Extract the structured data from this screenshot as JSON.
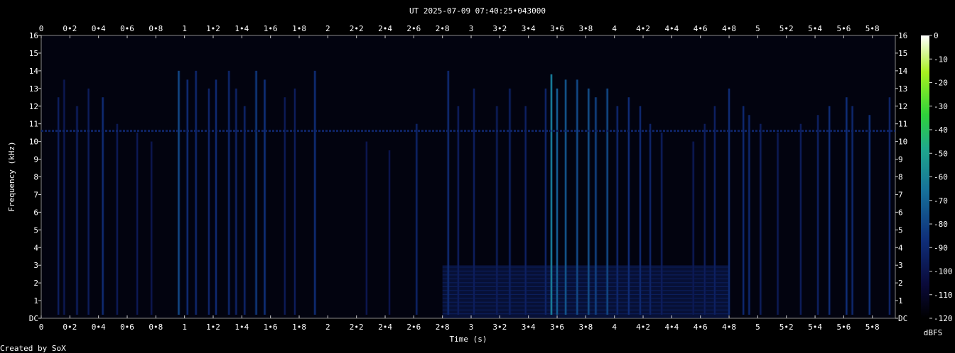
{
  "title": "UT 2025-07-09 07:40:25•043000",
  "credit": "Created by SoX",
  "chart_data": {
    "type": "heatmap",
    "xlabel": "Time (s)",
    "ylabel": "Frequency (kHz)",
    "xlim": [
      0,
      5.96
    ],
    "ylim": [
      0,
      16
    ],
    "x_ticks": [
      "0",
      "0•2",
      "0•4",
      "0•6",
      "0•8",
      "1",
      "1•2",
      "1•4",
      "1•6",
      "1•8",
      "2",
      "2•2",
      "2•4",
      "2•6",
      "2•8",
      "3",
      "3•2",
      "3•4",
      "3•6",
      "3•8",
      "4",
      "4•2",
      "4•4",
      "4•6",
      "4•8",
      "5",
      "5•2",
      "5•4",
      "5•6",
      "5•8"
    ],
    "y_ticks": [
      "DC",
      "1",
      "2",
      "3",
      "4",
      "5",
      "6",
      "7",
      "8",
      "9",
      "10",
      "11",
      "12",
      "13",
      "14",
      "15",
      "16"
    ],
    "colorbar": {
      "label": "dBFS",
      "ticks": [
        "0",
        "-10",
        "-20",
        "-30",
        "-40",
        "-50",
        "-60",
        "-70",
        "-80",
        "-90",
        "-100",
        "-110",
        "-120"
      ],
      "range": [
        -120,
        0
      ],
      "colors": [
        "#000000",
        "#0a0a3a",
        "#0f2f7a",
        "#16709a",
        "#1fa88c",
        "#2fd23a",
        "#a8f020",
        "#ffffff"
      ]
    },
    "tones": [
      {
        "freq_khz": 10.6,
        "t_start": 0,
        "t_end": 5.96,
        "level_db": -92
      }
    ],
    "events": [
      {
        "t": 0.12,
        "top_khz": 12.5,
        "level_db": -95
      },
      {
        "t": 0.16,
        "top_khz": 13.5,
        "level_db": -98
      },
      {
        "t": 0.25,
        "top_khz": 12.0,
        "level_db": -94
      },
      {
        "t": 0.33,
        "top_khz": 13.0,
        "level_db": -96
      },
      {
        "t": 0.43,
        "top_khz": 12.5,
        "level_db": -88
      },
      {
        "t": 0.53,
        "top_khz": 11.0,
        "level_db": -97
      },
      {
        "t": 0.67,
        "top_khz": 10.5,
        "level_db": -98
      },
      {
        "t": 0.77,
        "top_khz": 10.0,
        "level_db": -99
      },
      {
        "t": 0.96,
        "top_khz": 14.0,
        "level_db": -78
      },
      {
        "t": 1.02,
        "top_khz": 13.5,
        "level_db": -88
      },
      {
        "t": 1.08,
        "top_khz": 14.0,
        "level_db": -90
      },
      {
        "t": 1.17,
        "top_khz": 13.0,
        "level_db": -92
      },
      {
        "t": 1.22,
        "top_khz": 13.5,
        "level_db": -89
      },
      {
        "t": 1.31,
        "top_khz": 14.0,
        "level_db": -90
      },
      {
        "t": 1.36,
        "top_khz": 13.0,
        "level_db": -92
      },
      {
        "t": 1.42,
        "top_khz": 12.0,
        "level_db": -91
      },
      {
        "t": 1.5,
        "top_khz": 14.0,
        "level_db": -83
      },
      {
        "t": 1.56,
        "top_khz": 13.5,
        "level_db": -86
      },
      {
        "t": 1.7,
        "top_khz": 12.5,
        "level_db": -97
      },
      {
        "t": 1.77,
        "top_khz": 13.0,
        "level_db": -96
      },
      {
        "t": 1.91,
        "top_khz": 14.0,
        "level_db": -87
      },
      {
        "t": 2.27,
        "top_khz": 10.0,
        "level_db": -99
      },
      {
        "t": 2.43,
        "top_khz": 9.5,
        "level_db": -100
      },
      {
        "t": 2.62,
        "top_khz": 11.0,
        "level_db": -92
      },
      {
        "t": 2.84,
        "top_khz": 14.0,
        "level_db": -88
      },
      {
        "t": 2.91,
        "top_khz": 12.0,
        "level_db": -95
      },
      {
        "t": 3.02,
        "top_khz": 13.0,
        "level_db": -95
      },
      {
        "t": 3.18,
        "top_khz": 12.0,
        "level_db": -95
      },
      {
        "t": 3.27,
        "top_khz": 13.0,
        "level_db": -93
      },
      {
        "t": 3.38,
        "top_khz": 12.0,
        "level_db": -94
      },
      {
        "t": 3.52,
        "top_khz": 13.0,
        "level_db": -92
      },
      {
        "t": 3.56,
        "top_khz": 13.8,
        "level_db": -62
      },
      {
        "t": 3.6,
        "top_khz": 13.0,
        "level_db": -72
      },
      {
        "t": 3.66,
        "top_khz": 13.5,
        "level_db": -74
      },
      {
        "t": 3.74,
        "top_khz": 13.5,
        "level_db": -78
      },
      {
        "t": 3.82,
        "top_khz": 13.0,
        "level_db": -76
      },
      {
        "t": 3.87,
        "top_khz": 12.5,
        "level_db": -80
      },
      {
        "t": 3.95,
        "top_khz": 13.0,
        "level_db": -78
      },
      {
        "t": 4.02,
        "top_khz": 12.0,
        "level_db": -90
      },
      {
        "t": 4.1,
        "top_khz": 12.5,
        "level_db": -88
      },
      {
        "t": 4.18,
        "top_khz": 12.0,
        "level_db": -90
      },
      {
        "t": 4.25,
        "top_khz": 11.0,
        "level_db": -92
      },
      {
        "t": 4.33,
        "top_khz": 10.5,
        "level_db": -95
      },
      {
        "t": 4.55,
        "top_khz": 10.0,
        "level_db": -97
      },
      {
        "t": 4.63,
        "top_khz": 11.0,
        "level_db": -96
      },
      {
        "t": 4.7,
        "top_khz": 12.0,
        "level_db": -94
      },
      {
        "t": 4.8,
        "top_khz": 13.0,
        "level_db": -88
      },
      {
        "t": 4.9,
        "top_khz": 12.0,
        "level_db": -90
      },
      {
        "t": 4.94,
        "top_khz": 11.5,
        "level_db": -90
      },
      {
        "t": 5.02,
        "top_khz": 11.0,
        "level_db": -95
      },
      {
        "t": 5.14,
        "top_khz": 10.5,
        "level_db": -97
      },
      {
        "t": 5.3,
        "top_khz": 11.0,
        "level_db": -96
      },
      {
        "t": 5.42,
        "top_khz": 11.5,
        "level_db": -94
      },
      {
        "t": 5.5,
        "top_khz": 12.0,
        "level_db": -88
      },
      {
        "t": 5.62,
        "top_khz": 12.5,
        "level_db": -87
      },
      {
        "t": 5.66,
        "top_khz": 12.0,
        "level_db": -90
      },
      {
        "t": 5.78,
        "top_khz": 11.5,
        "level_db": -86
      },
      {
        "t": 5.92,
        "top_khz": 12.5,
        "level_db": -92
      }
    ],
    "harmonic_bands": [
      {
        "t_start": 2.8,
        "t_end": 4.8,
        "top_khz": 3.0,
        "level_db": -97
      }
    ]
  }
}
